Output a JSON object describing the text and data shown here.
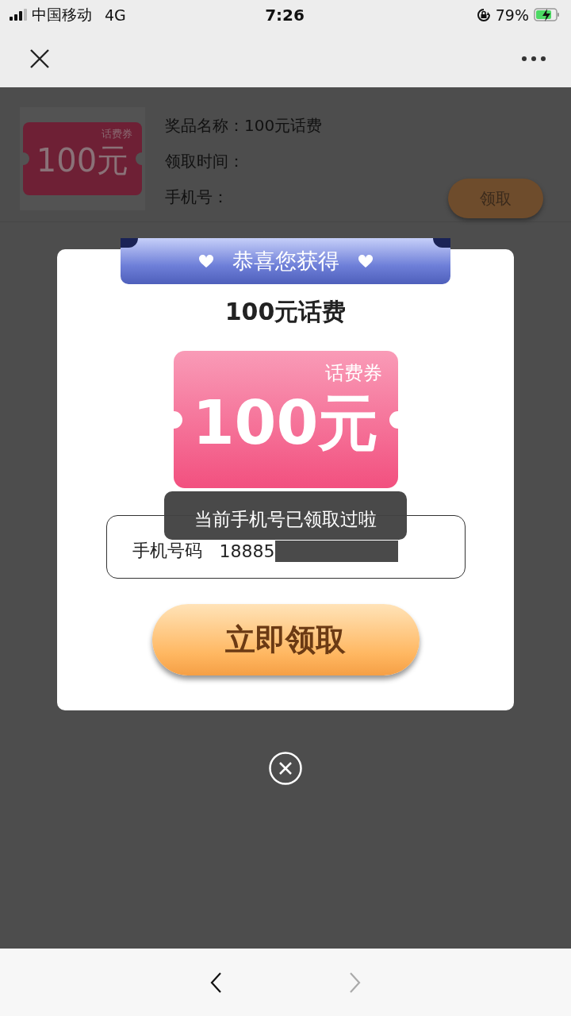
{
  "status_bar": {
    "carrier": "中国移动",
    "network": "4G",
    "time": "7:26",
    "battery": "79%"
  },
  "prize_card": {
    "coupon_tag": "话费券",
    "coupon_amount": "100元",
    "fields": [
      "奖品名称：100元话费",
      "领取时间：",
      "手机号："
    ],
    "button": "领取"
  },
  "dialog": {
    "ribbon_title": "恭喜您获得",
    "prize_name": "100元话费",
    "coupon_tag": "话费券",
    "coupon_amount": "100元",
    "phone_field": {
      "label": "手机号码",
      "value": "18885"
    },
    "toast": "当前手机号已领取过啦",
    "claim_button": "立即领取"
  },
  "bottom_nav": [
    {
      "kind": "back",
      "disabled": false
    },
    {
      "kind": "forward",
      "disabled": true
    }
  ]
}
